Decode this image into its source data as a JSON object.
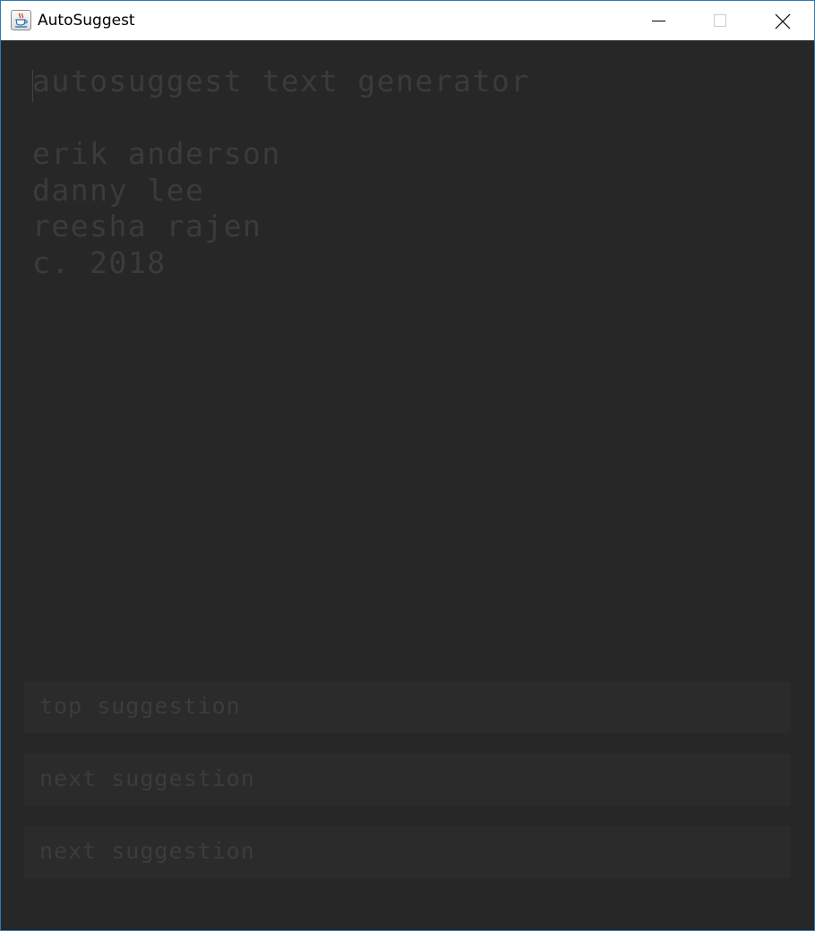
{
  "window": {
    "title": "AutoSuggest",
    "icon": "java-cup-icon"
  },
  "editor": {
    "title": "autosuggest text generator",
    "lines": [
      "erik anderson",
      "danny lee",
      "reesha rajen",
      "c. 2018"
    ]
  },
  "suggestions": [
    {
      "label": "top suggestion"
    },
    {
      "label": "next suggestion"
    },
    {
      "label": "next suggestion"
    }
  ],
  "colors": {
    "background": "#282728",
    "text": "#3c3b3c",
    "suggestion_background": "#2c2b2c"
  }
}
